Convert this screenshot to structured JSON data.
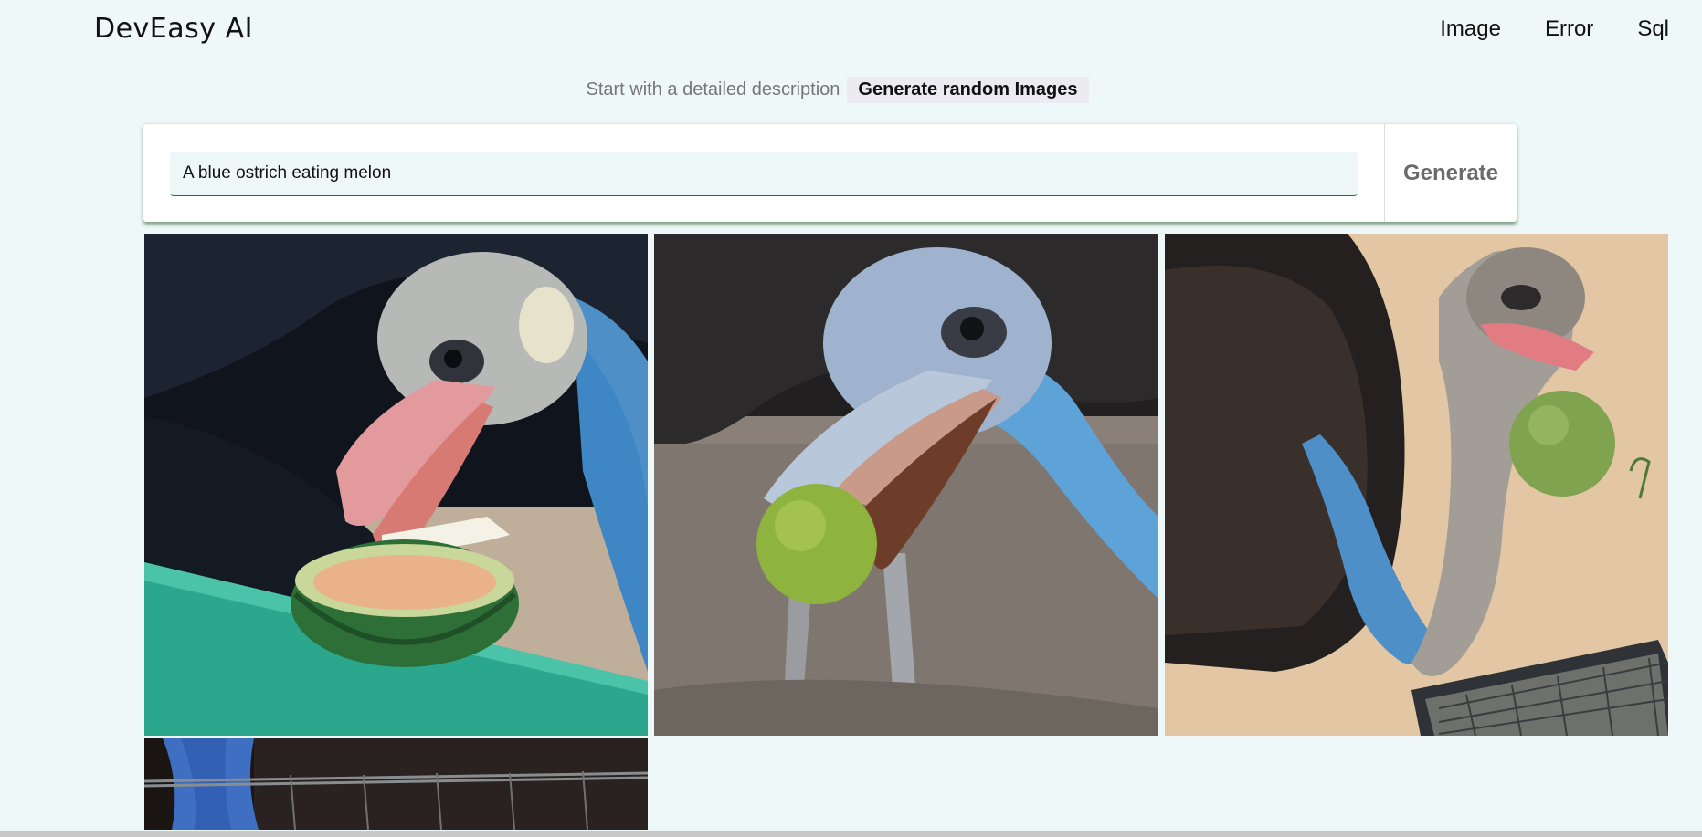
{
  "header": {
    "logo": "DevEasy AI",
    "nav": [
      {
        "label": "Image"
      },
      {
        "label": "Error"
      },
      {
        "label": "Sql"
      }
    ]
  },
  "subline": {
    "hint": "Start with a detailed description",
    "random_label": "Generate random Images"
  },
  "prompt": {
    "value": "A blue ostrich eating melon",
    "generate_label": "Generate"
  },
  "gallery": {
    "images": [
      {
        "subject": "blue ostrich eating half melon on green rail"
      },
      {
        "subject": "blue ostrich holding green fruit in beak"
      },
      {
        "subject": "ostrich with green fruit in beak near wire tray"
      },
      {
        "subject": "blue ostrich neck behind wire fence"
      }
    ]
  },
  "colors": {
    "background": "#eef8f8",
    "card": "#ffffff",
    "input_underline": "#2e6b3a",
    "generate_text": "#6b6b6b"
  }
}
